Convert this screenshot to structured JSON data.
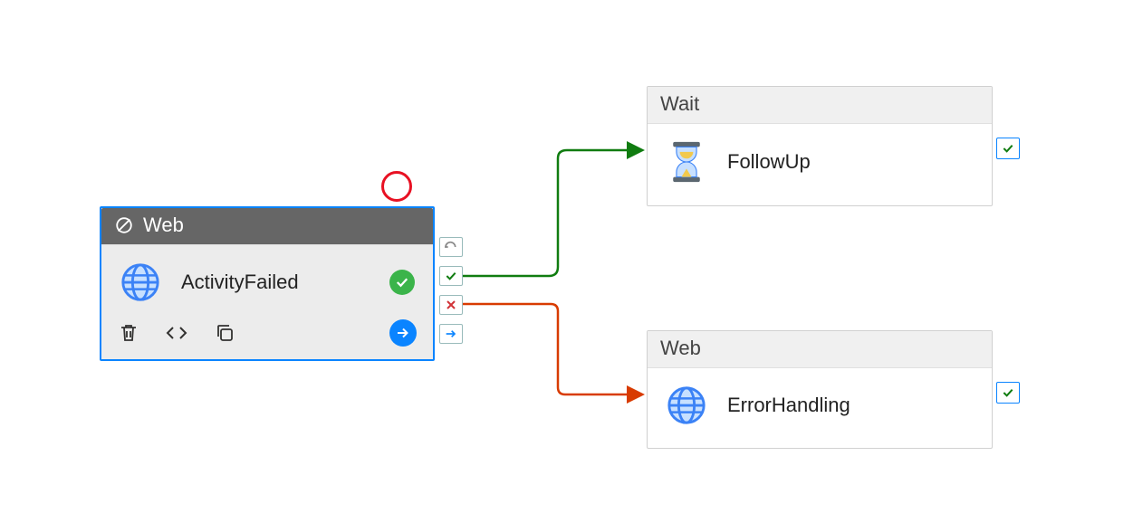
{
  "nodes": {
    "source": {
      "type_label": "Web",
      "activity_label": "ActivityFailed",
      "status": "succeeded"
    },
    "followup": {
      "type_label": "Wait",
      "activity_label": "FollowUp"
    },
    "errorhandling": {
      "type_label": "Web",
      "activity_label": "ErrorHandling"
    }
  },
  "connectors": {
    "success": {
      "from": "source",
      "to": "followup",
      "kind": "success"
    },
    "failure": {
      "from": "source",
      "to": "errorhandling",
      "kind": "failure"
    }
  },
  "colors": {
    "selected_border": "#0a84ff",
    "success_line": "#107c10",
    "failure_line": "#d83b01",
    "status_ok": "#3bb44a",
    "breakpoint": "#e81123"
  }
}
